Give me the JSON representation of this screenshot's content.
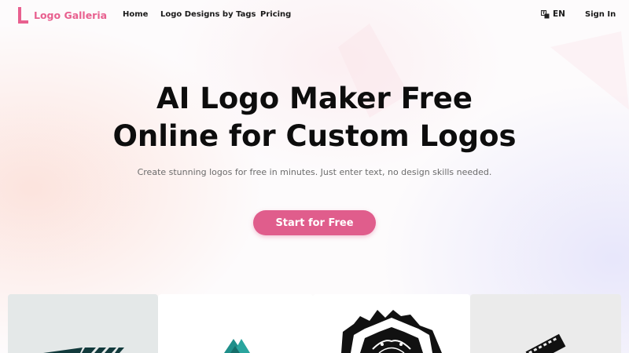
{
  "brand": {
    "name": "Logo Galleria",
    "color": "#e8608f"
  },
  "nav": {
    "links": [
      "Home",
      "Logo Designs by Tags",
      "Pricing"
    ],
    "language": {
      "icon": "translate-icon",
      "label": "EN"
    },
    "signin_label": "Sign In"
  },
  "hero": {
    "title_line1": "AI Logo Maker Free",
    "title_line2": "Online for Custom Logos",
    "subtitle": "Create stunning logos for free in minutes. Just enter text, no design skills needed.",
    "cta_label": "Start for Free",
    "cta_color": "#e05d8c"
  },
  "gallery": {
    "cards": [
      {
        "icon": "abstract-stripes-logo"
      },
      {
        "icon": "teal-mountain-logo"
      },
      {
        "icon": "animal-crest-logo"
      },
      {
        "icon": "film-strip-logo"
      }
    ]
  }
}
